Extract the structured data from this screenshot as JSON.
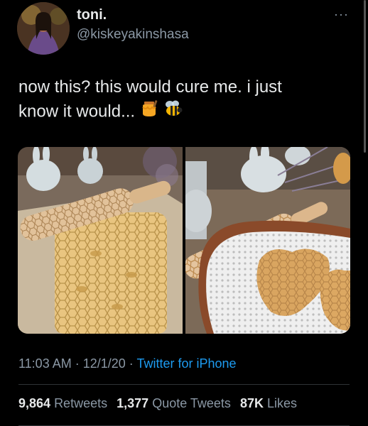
{
  "author": {
    "name": "toni.",
    "handle": "@kiskeyakinshasa"
  },
  "tweet": {
    "text_line1": "now this? this would cure me. i just",
    "text_line2": "know it would...",
    "emojis": [
      "honey-pot-icon",
      "bee-icon"
    ]
  },
  "meta": {
    "time": "11:03 AM",
    "sep1": " · ",
    "date": "12/1/20",
    "sep2": " · ",
    "source": "Twitter for iPhone"
  },
  "stats": {
    "retweets_count": "9,864",
    "retweets_label": "Retweets",
    "quotes_count": "1,377",
    "quotes_label": "Quote Tweets",
    "likes_count": "87K",
    "likes_label": "Likes"
  },
  "more_glyph": "···",
  "colors": {
    "background": "#000000",
    "text": "#e7e9ea",
    "secondary": "#8b98a5",
    "link": "#1d9bf0",
    "divider": "#2f3336"
  }
}
